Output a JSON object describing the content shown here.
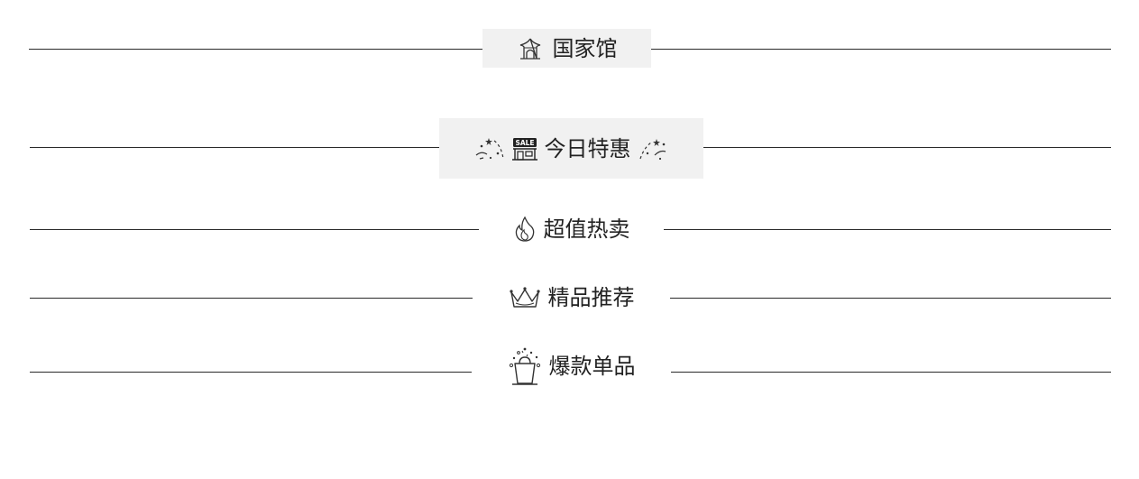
{
  "sections": [
    {
      "label": "国家馆",
      "icon": "pavilion-icon"
    },
    {
      "label": "今日特惠",
      "icon": "sale-shop-icon",
      "decoration_left": "confetti-left-icon",
      "decoration_right": "confetti-right-icon",
      "badge_text": "SALE"
    },
    {
      "label": "超值热卖",
      "icon": "flame-icon"
    },
    {
      "label": "精品推荐",
      "icon": "crown-icon"
    },
    {
      "label": "爆款单品",
      "icon": "sparkling-bag-icon"
    }
  ],
  "colors": {
    "line": "#2a2a2a",
    "shaded_box": "#f1f1f1",
    "text": "#222222"
  }
}
